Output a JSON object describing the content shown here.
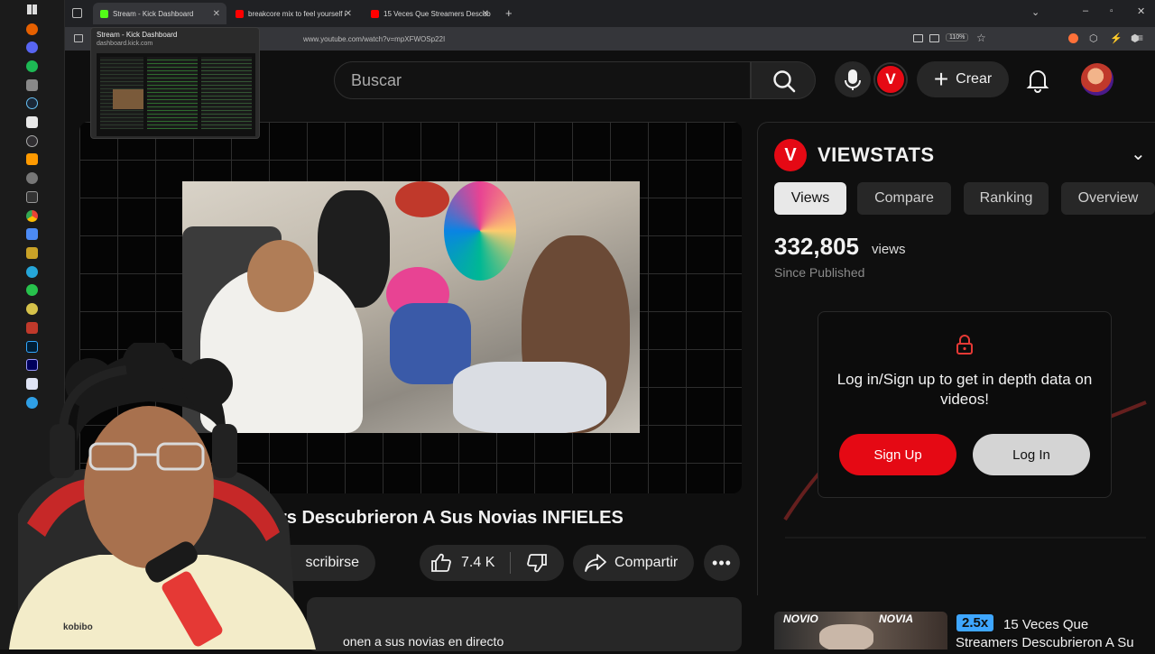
{
  "browser": {
    "tabs": [
      {
        "title": "Stream - Kick Dashboard",
        "favicon_color": "#53fc18"
      },
      {
        "title": "breakcore mix to feel yourself i",
        "favicon_color": "#ff0000"
      },
      {
        "title": "15 Veces Que Streamers Descub",
        "favicon_color": "#ff0000"
      }
    ],
    "new_tab": "+",
    "url": "www.youtube.com/watch?v=mpXFWOSp22I",
    "zoom": "110%",
    "tooltip": {
      "title": "Stream - Kick Dashboard",
      "domain": "dashboard.kick.com"
    }
  },
  "youtube": {
    "search_placeholder": "Buscar",
    "create_label": "Crear",
    "video_title": "rs Descubrieron A Sus Novias INFIELES",
    "subscribe_label": "scribirse",
    "like_count": "7.4 K",
    "share_label": "Compartir",
    "description_snippet": "onen a sus novias en directo"
  },
  "viewstats": {
    "brand": "VIEWSTATS",
    "logo_letter": "V",
    "tabs": [
      "Views",
      "Compare",
      "Ranking",
      "Overview"
    ],
    "active_tab": "Views",
    "views_value": "332,805",
    "views_unit": "views",
    "since": "Since Published",
    "lock_message": "Log in/Sign up to get in depth data on videos!",
    "signup_label": "Sign Up",
    "login_label": "Log In",
    "accent": "#e50914"
  },
  "recommendation": {
    "thumb_labels": [
      "NOVIO",
      "NOVIA"
    ],
    "speed_badge": "2.5x",
    "title_line1": "15 Veces Que",
    "title_line2": "Streamers Descubrieron A Su"
  }
}
